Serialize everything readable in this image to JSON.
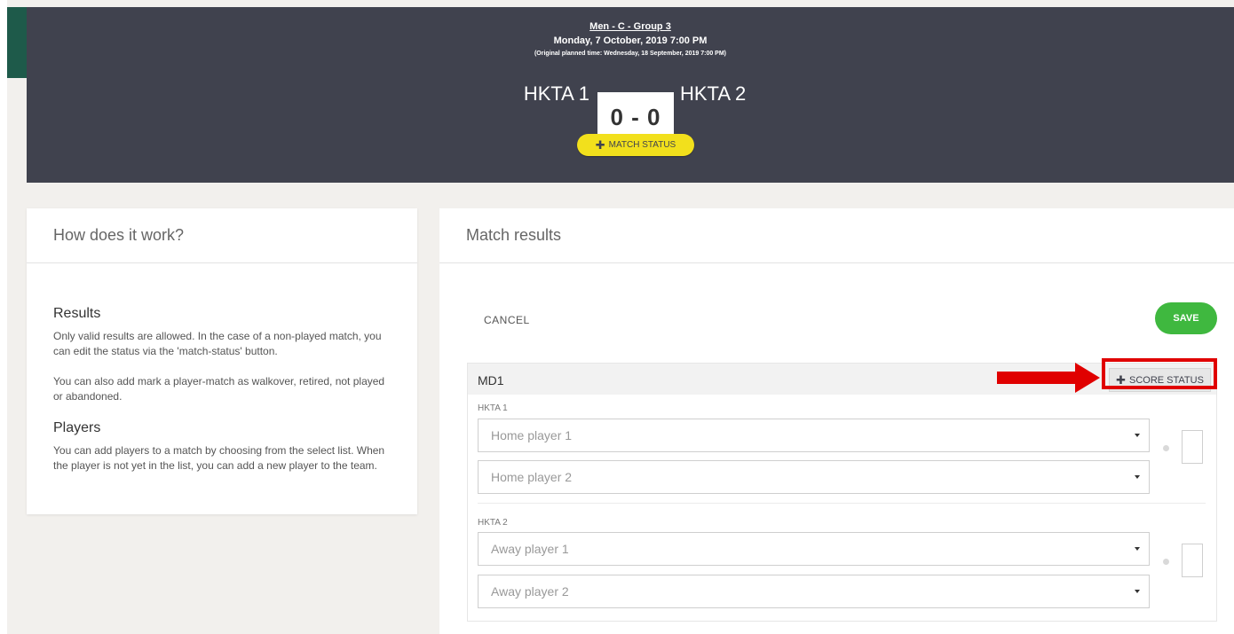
{
  "match": {
    "group_title": "Men - C - Group 3",
    "datetime": "Monday, 7 October, 2019 7:00 PM",
    "original_planned": "(Original planned time: Wednesday, 18 September, 2019 7:00 PM)",
    "home_team": "HKTA 1",
    "away_team": "HKTA 2",
    "score": "0 - 0",
    "match_status_label": "MATCH STATUS"
  },
  "how_it_works": {
    "title": "How does it work?",
    "results_heading": "Results",
    "results_text_1": "Only valid results are allowed. In the case of a non-played match, you can edit the status via the 'match-status' button.",
    "results_text_2": "You can also add mark a player-match as walkover, retired, not played or abandoned.",
    "players_heading": "Players",
    "players_text": "You can add players to a match by choosing from the select list. When the player is not yet in the list, you can add a new player to the team."
  },
  "match_results": {
    "title": "Match results",
    "cancel_label": "CANCEL",
    "save_label": "SAVE",
    "md_label": "MD1",
    "score_status_label": "SCORE STATUS",
    "home_team_label": "HKTA 1",
    "away_team_label": "HKTA 2",
    "home_player_1_placeholder": "Home player 1",
    "home_player_2_placeholder": "Home player 2",
    "away_player_1_placeholder": "Away player 1",
    "away_player_2_placeholder": "Away player 2"
  },
  "colors": {
    "header_bg": "#40424e",
    "accent_yellow": "#f2e01c",
    "save_green": "#3fb83f",
    "annotation_red": "#e00000",
    "brand_green": "#1e5a4a"
  },
  "icons": {
    "plus": "plus-icon",
    "caret": "chevron-down-icon",
    "arrow": "arrow-right-icon"
  }
}
